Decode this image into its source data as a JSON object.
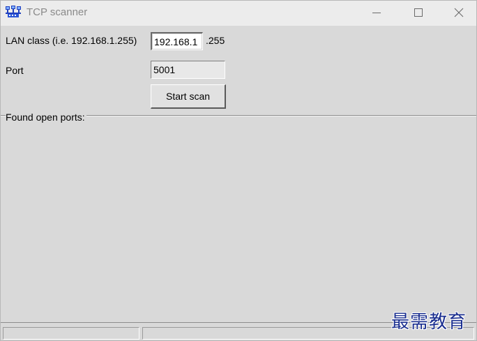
{
  "window": {
    "title": "TCP scanner",
    "controls": {
      "minimize_icon": "minimize-icon",
      "maximize_icon": "maximize-icon",
      "close_icon": "close-icon"
    }
  },
  "form": {
    "lan_label": "LAN class (i.e. 192.168.1.255)",
    "lan_value": "192.168.1",
    "lan_suffix": ".255",
    "port_label": "Port",
    "port_value": "5001",
    "start_button_label": "Start scan"
  },
  "results": {
    "label": "Found open ports:",
    "items": []
  },
  "statusbar": {
    "pane1_text": "",
    "pane2_text": ""
  },
  "watermark": {
    "text": "最需教育"
  },
  "colors": {
    "window_bg": "#d9d9d9",
    "titlebar_bg": "#ececec",
    "title_text": "#8a8a8a",
    "watermark": "#1a2e8f"
  }
}
